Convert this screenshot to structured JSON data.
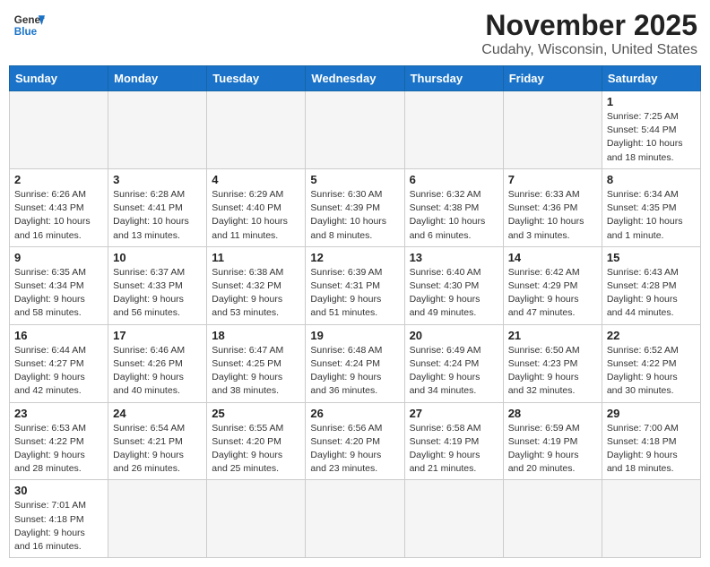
{
  "header": {
    "logo_general": "General",
    "logo_blue": "Blue",
    "title": "November 2025",
    "subtitle": "Cudahy, Wisconsin, United States"
  },
  "weekdays": [
    "Sunday",
    "Monday",
    "Tuesday",
    "Wednesday",
    "Thursday",
    "Friday",
    "Saturday"
  ],
  "weeks": [
    [
      {
        "day": "",
        "info": ""
      },
      {
        "day": "",
        "info": ""
      },
      {
        "day": "",
        "info": ""
      },
      {
        "day": "",
        "info": ""
      },
      {
        "day": "",
        "info": ""
      },
      {
        "day": "",
        "info": ""
      },
      {
        "day": "1",
        "info": "Sunrise: 7:25 AM\nSunset: 5:44 PM\nDaylight: 10 hours\nand 18 minutes."
      }
    ],
    [
      {
        "day": "2",
        "info": "Sunrise: 6:26 AM\nSunset: 4:43 PM\nDaylight: 10 hours\nand 16 minutes."
      },
      {
        "day": "3",
        "info": "Sunrise: 6:28 AM\nSunset: 4:41 PM\nDaylight: 10 hours\nand 13 minutes."
      },
      {
        "day": "4",
        "info": "Sunrise: 6:29 AM\nSunset: 4:40 PM\nDaylight: 10 hours\nand 11 minutes."
      },
      {
        "day": "5",
        "info": "Sunrise: 6:30 AM\nSunset: 4:39 PM\nDaylight: 10 hours\nand 8 minutes."
      },
      {
        "day": "6",
        "info": "Sunrise: 6:32 AM\nSunset: 4:38 PM\nDaylight: 10 hours\nand 6 minutes."
      },
      {
        "day": "7",
        "info": "Sunrise: 6:33 AM\nSunset: 4:36 PM\nDaylight: 10 hours\nand 3 minutes."
      },
      {
        "day": "8",
        "info": "Sunrise: 6:34 AM\nSunset: 4:35 PM\nDaylight: 10 hours\nand 1 minute."
      }
    ],
    [
      {
        "day": "9",
        "info": "Sunrise: 6:35 AM\nSunset: 4:34 PM\nDaylight: 9 hours\nand 58 minutes."
      },
      {
        "day": "10",
        "info": "Sunrise: 6:37 AM\nSunset: 4:33 PM\nDaylight: 9 hours\nand 56 minutes."
      },
      {
        "day": "11",
        "info": "Sunrise: 6:38 AM\nSunset: 4:32 PM\nDaylight: 9 hours\nand 53 minutes."
      },
      {
        "day": "12",
        "info": "Sunrise: 6:39 AM\nSunset: 4:31 PM\nDaylight: 9 hours\nand 51 minutes."
      },
      {
        "day": "13",
        "info": "Sunrise: 6:40 AM\nSunset: 4:30 PM\nDaylight: 9 hours\nand 49 minutes."
      },
      {
        "day": "14",
        "info": "Sunrise: 6:42 AM\nSunset: 4:29 PM\nDaylight: 9 hours\nand 47 minutes."
      },
      {
        "day": "15",
        "info": "Sunrise: 6:43 AM\nSunset: 4:28 PM\nDaylight: 9 hours\nand 44 minutes."
      }
    ],
    [
      {
        "day": "16",
        "info": "Sunrise: 6:44 AM\nSunset: 4:27 PM\nDaylight: 9 hours\nand 42 minutes."
      },
      {
        "day": "17",
        "info": "Sunrise: 6:46 AM\nSunset: 4:26 PM\nDaylight: 9 hours\nand 40 minutes."
      },
      {
        "day": "18",
        "info": "Sunrise: 6:47 AM\nSunset: 4:25 PM\nDaylight: 9 hours\nand 38 minutes."
      },
      {
        "day": "19",
        "info": "Sunrise: 6:48 AM\nSunset: 4:24 PM\nDaylight: 9 hours\nand 36 minutes."
      },
      {
        "day": "20",
        "info": "Sunrise: 6:49 AM\nSunset: 4:24 PM\nDaylight: 9 hours\nand 34 minutes."
      },
      {
        "day": "21",
        "info": "Sunrise: 6:50 AM\nSunset: 4:23 PM\nDaylight: 9 hours\nand 32 minutes."
      },
      {
        "day": "22",
        "info": "Sunrise: 6:52 AM\nSunset: 4:22 PM\nDaylight: 9 hours\nand 30 minutes."
      }
    ],
    [
      {
        "day": "23",
        "info": "Sunrise: 6:53 AM\nSunset: 4:22 PM\nDaylight: 9 hours\nand 28 minutes."
      },
      {
        "day": "24",
        "info": "Sunrise: 6:54 AM\nSunset: 4:21 PM\nDaylight: 9 hours\nand 26 minutes."
      },
      {
        "day": "25",
        "info": "Sunrise: 6:55 AM\nSunset: 4:20 PM\nDaylight: 9 hours\nand 25 minutes."
      },
      {
        "day": "26",
        "info": "Sunrise: 6:56 AM\nSunset: 4:20 PM\nDaylight: 9 hours\nand 23 minutes."
      },
      {
        "day": "27",
        "info": "Sunrise: 6:58 AM\nSunset: 4:19 PM\nDaylight: 9 hours\nand 21 minutes."
      },
      {
        "day": "28",
        "info": "Sunrise: 6:59 AM\nSunset: 4:19 PM\nDaylight: 9 hours\nand 20 minutes."
      },
      {
        "day": "29",
        "info": "Sunrise: 7:00 AM\nSunset: 4:18 PM\nDaylight: 9 hours\nand 18 minutes."
      }
    ],
    [
      {
        "day": "30",
        "info": "Sunrise: 7:01 AM\nSunset: 4:18 PM\nDaylight: 9 hours\nand 16 minutes."
      },
      {
        "day": "",
        "info": ""
      },
      {
        "day": "",
        "info": ""
      },
      {
        "day": "",
        "info": ""
      },
      {
        "day": "",
        "info": ""
      },
      {
        "day": "",
        "info": ""
      },
      {
        "day": "",
        "info": ""
      }
    ]
  ]
}
